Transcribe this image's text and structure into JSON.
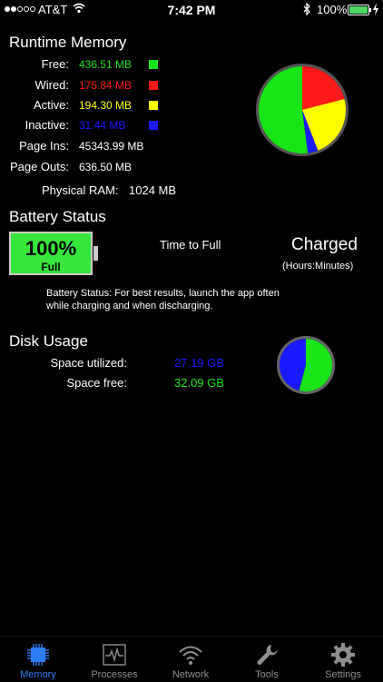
{
  "status_bar": {
    "carrier": "AT&T",
    "time": "7:42 PM",
    "battery_percent": "100%"
  },
  "runtime_memory": {
    "title": "Runtime Memory",
    "rows": [
      {
        "label": "Free:",
        "value": "436.51 MB",
        "color": "#18e418"
      },
      {
        "label": "Wired:",
        "value": "175.84 MB",
        "color": "#ff1a1a"
      },
      {
        "label": "Active:",
        "value": "194.30 MB",
        "color": "#ffff00"
      },
      {
        "label": "Inactive:",
        "value": "31.44 MB",
        "color": "#1a1aff"
      }
    ],
    "page_ins_label": "Page Ins:",
    "page_ins": "45343.99 MB",
    "page_outs_label": "Page Outs:",
    "page_outs": "636.50 MB",
    "physical_ram_label": "Physical RAM:",
    "physical_ram": "1024 MB"
  },
  "battery_status": {
    "title": "Battery Status",
    "percent": "100%",
    "level_text": "Full",
    "time_label": "Time to Full",
    "state": "Charged",
    "units": "(Hours:Minutes)",
    "note_line1": "Battery Status: For best results, launch the app often",
    "note_line2": "while charging and when discharging."
  },
  "disk_usage": {
    "title": "Disk Usage",
    "utilized_label": "Space utilized:",
    "utilized": "27.19 GB",
    "free_label": "Space free:",
    "free": "32.09 GB",
    "utilized_color": "#1a1aff",
    "free_color": "#18e418"
  },
  "chart_data": [
    {
      "type": "pie",
      "categories": [
        "Free",
        "Wired",
        "Active",
        "Inactive"
      ],
      "values": [
        436.51,
        175.84,
        194.3,
        31.44
      ],
      "colors": [
        "#18e418",
        "#ff1a1a",
        "#ffff00",
        "#1a1aff"
      ]
    },
    {
      "type": "pie",
      "categories": [
        "Space utilized",
        "Space free"
      ],
      "values": [
        27.19,
        32.09
      ],
      "colors": [
        "#1a1aff",
        "#18e418"
      ]
    }
  ],
  "tabs": [
    {
      "label": "Memory",
      "icon": "chip-icon",
      "active": true
    },
    {
      "label": "Processes",
      "icon": "pulse-chart-icon",
      "active": false
    },
    {
      "label": "Network",
      "icon": "wifi-icon",
      "active": false
    },
    {
      "label": "Tools",
      "icon": "wrench-icon",
      "active": false
    },
    {
      "label": "Settings",
      "icon": "gear-icon",
      "active": false
    }
  ]
}
